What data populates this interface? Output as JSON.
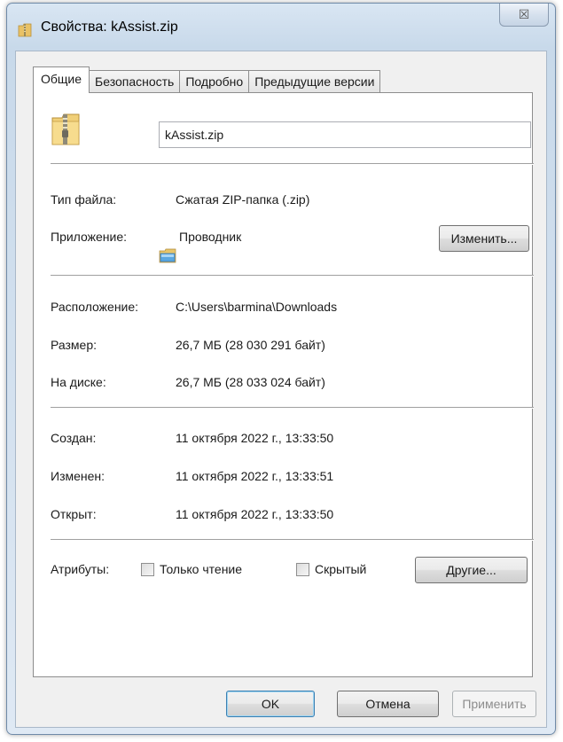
{
  "window": {
    "title": "Свойства: kAssist.zip",
    "close_glyph": "☒"
  },
  "tabs": [
    {
      "label": "Общие",
      "active": true
    },
    {
      "label": "Безопасность",
      "active": false
    },
    {
      "label": "Подробно",
      "active": false
    },
    {
      "label": "Предыдущие версии",
      "active": false
    }
  ],
  "general": {
    "file_name": "kAssist.zip",
    "file_type_label": "Тип файла:",
    "file_type_value": "Сжатая ZIP-папка (.zip)",
    "app_label": "Приложение:",
    "app_value": "Проводник",
    "change_button": "Изменить...",
    "location_label": "Расположение:",
    "location_value": "C:\\Users\\barmina\\Downloads",
    "size_label": "Размер:",
    "size_value": "26,7 МБ (28 030 291 байт)",
    "disk_label": "На диске:",
    "disk_value": "26,7 МБ (28 033 024 байт)",
    "created_label": "Создан:",
    "created_value": "11 октября 2022 г., 13:33:50",
    "modified_label": "Изменен:",
    "modified_value": "11 октября 2022 г., 13:33:51",
    "opened_label": "Открыт:",
    "opened_value": "11 октября 2022 г., 13:33:50",
    "attributes_label": "Атрибуты:",
    "readonly_label": "Только чтение",
    "readonly_checked": false,
    "hidden_label": "Скрытый",
    "hidden_checked": false,
    "other_button": "Другие..."
  },
  "footer": {
    "ok": "OK",
    "cancel": "Отмена",
    "apply": "Применить"
  },
  "icons": {
    "title": "zip-folder-icon",
    "file": "zip-folder-icon",
    "app": "explorer-icon"
  }
}
